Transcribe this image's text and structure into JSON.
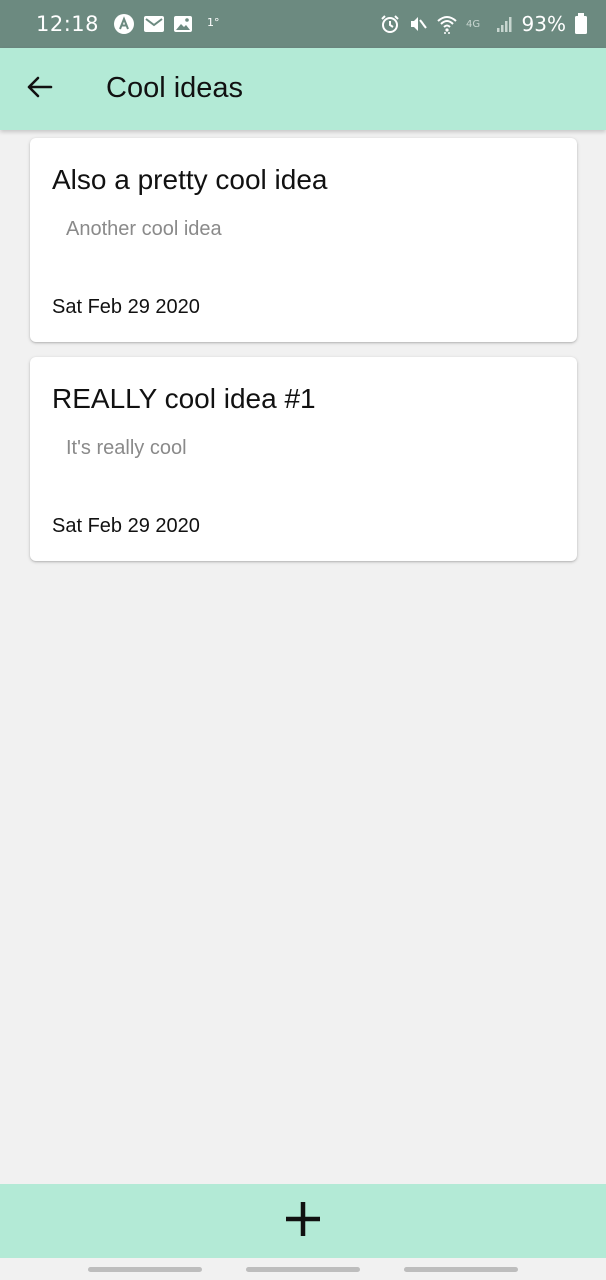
{
  "status_bar": {
    "time": "12:18",
    "temp": "1°",
    "battery": "93%",
    "icons_left": [
      "app-a-icon",
      "mail-icon",
      "image-icon"
    ],
    "icons_right": [
      "alarm-icon",
      "mute-vibrate-icon",
      "wifi-icon",
      "4g-icon",
      "signal-icon",
      "battery-icon"
    ]
  },
  "app_bar": {
    "title": "Cool ideas",
    "back_icon": "arrow-back-icon"
  },
  "ideas": [
    {
      "title": "Also a pretty cool idea",
      "description": "Another cool idea",
      "date": "Sat Feb 29 2020"
    },
    {
      "title": "REALLY cool idea #1",
      "description": "It's really cool",
      "date": "Sat Feb 29 2020"
    }
  ],
  "bottom_bar": {
    "add_icon": "plus-icon"
  },
  "colors": {
    "status_bar": "#6c8a80",
    "accent": "#b3ead6",
    "background": "#f1f1f1",
    "card": "#ffffff",
    "muted_text": "#8a8a8a"
  }
}
